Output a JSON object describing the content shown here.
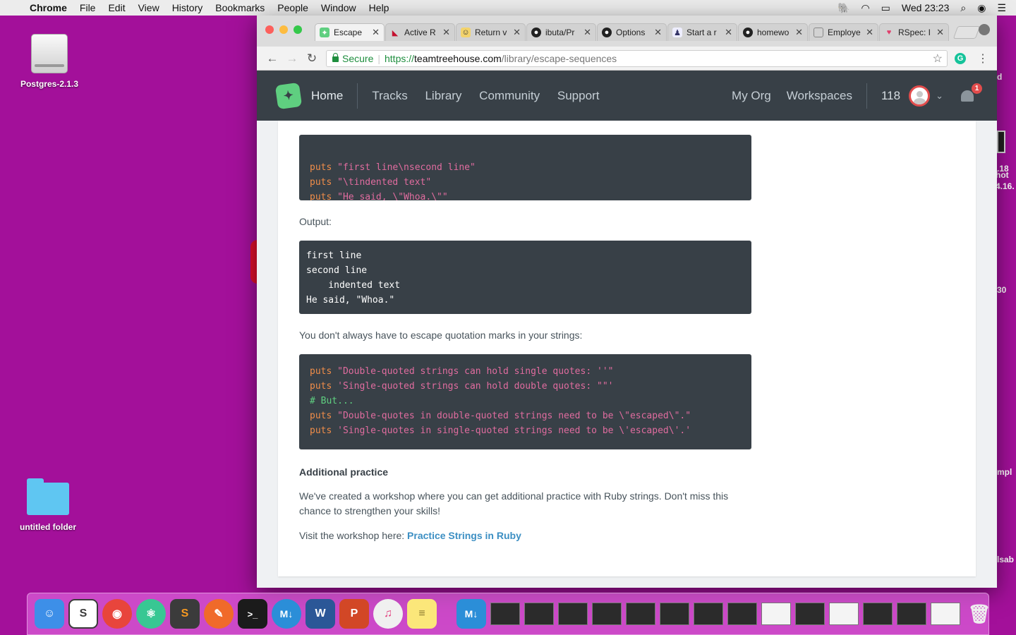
{
  "menubar": {
    "app": "Chrome",
    "items": [
      "File",
      "Edit",
      "View",
      "History",
      "Bookmarks",
      "People",
      "Window",
      "Help"
    ],
    "clock": "Wed 23:23"
  },
  "desktop": {
    "drive_label": "Postgres-2.1.3",
    "folder_label": "untitled folder",
    "peek_texts": [
      "d",
      ".18",
      "hot",
      "4.16.",
      "30",
      "mpl",
      "lsab"
    ]
  },
  "browser": {
    "tabs": [
      {
        "title": "Escape",
        "active": true
      },
      {
        "title": "Active R"
      },
      {
        "title": "Return v"
      },
      {
        "title": "ibuta/Pr"
      },
      {
        "title": "Options"
      },
      {
        "title": "Start a r"
      },
      {
        "title": "homewo"
      },
      {
        "title": "Employe"
      },
      {
        "title": "RSpec: I"
      }
    ],
    "secure_label": "Secure",
    "url_scheme": "https://",
    "url_host": "teamtreehouse.com",
    "url_path": "/library/escape-sequences"
  },
  "site": {
    "home": "Home",
    "nav": [
      "Tracks",
      "Library",
      "Community",
      "Support"
    ],
    "right_nav": [
      "My Org",
      "Workspaces"
    ],
    "points": "118",
    "notification_count": "1"
  },
  "article": {
    "code1": [
      {
        "kw": "puts",
        "str": "\"first line\\nsecond line\""
      },
      {
        "kw": "puts",
        "str": "\"\\tindented text\""
      },
      {
        "kw": "puts",
        "str": "\"He said, \\\"Whoa.\\\"\""
      }
    ],
    "output_label": "Output:",
    "output_lines": [
      "first line",
      "second line",
      "    indented text",
      "He said, \"Whoa.\""
    ],
    "quotes_para": "You don't always have to escape quotation marks in your strings:",
    "code2": [
      {
        "kw": "puts",
        "str": "\"Double-quoted strings can hold single quotes: ''\""
      },
      {
        "kw": "puts",
        "str": "'Single-quoted strings can hold double quotes: \"\"'"
      },
      {
        "comment": "# But..."
      },
      {
        "kw": "puts",
        "str": "\"Double-quotes in double-quoted strings need to be \\\"escaped\\\".\""
      },
      {
        "kw": "puts",
        "str": "'Single-quotes in single-quoted strings need to be \\'escaped\\'.'"
      }
    ],
    "practice_heading": "Additional practice",
    "practice_para": "We've created a workshop where you can get additional practice with Ruby strings. Don't miss this chance to strengthen your skills!",
    "visit_text": "Visit the workshop here: ",
    "workshop_link": "Practice Strings in Ruby"
  },
  "dock": {
    "apps": [
      {
        "name": "finder-icon",
        "color": "#3d8fe8",
        "glyph": "☺"
      },
      {
        "name": "slack-icon",
        "color": "#ffffff",
        "glyph": "S"
      },
      {
        "name": "chrome-icon",
        "color": "#e8453c",
        "glyph": "◉"
      },
      {
        "name": "atom-icon",
        "color": "#38c793",
        "glyph": "⚛"
      },
      {
        "name": "sublime-icon",
        "color": "#3b3b3b",
        "glyph": "S"
      },
      {
        "name": "paw-icon",
        "color": "#f06a2a",
        "glyph": "✎"
      },
      {
        "name": "terminal-icon",
        "color": "#1b1b1b",
        "glyph": ">_"
      },
      {
        "name": "markdown-icon",
        "color": "#2b8ed8",
        "glyph": "M↓"
      },
      {
        "name": "word-icon",
        "color": "#2b5797",
        "glyph": "W"
      },
      {
        "name": "powerpoint-icon",
        "color": "#d24726",
        "glyph": "P"
      },
      {
        "name": "itunes-icon",
        "color": "#f0f0f0",
        "glyph": "♫"
      },
      {
        "name": "notes-icon",
        "color": "#fbe77a",
        "glyph": "≡"
      }
    ],
    "minimized_count": 14,
    "trash_glyph": "🗑"
  }
}
